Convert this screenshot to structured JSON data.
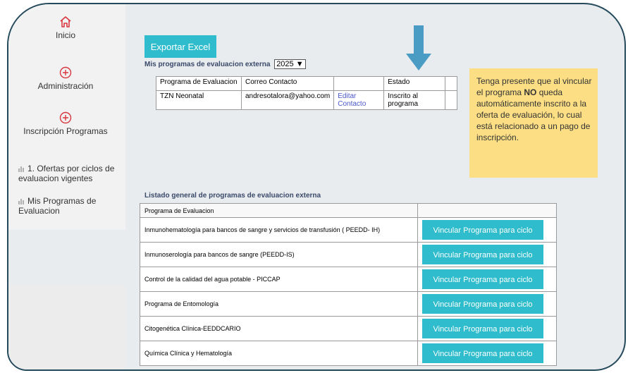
{
  "sidebar": {
    "home_label": "Inicio",
    "admin_label": "Administración",
    "inscripcion_label": "Inscripción Programas",
    "menu": [
      {
        "label": "1. Ofertas por ciclos de evaluacion vigentes"
      },
      {
        "label": "Mis Programas de Evaluacion"
      }
    ]
  },
  "toolbar": {
    "export_label": "Exportar Excel"
  },
  "my_programs": {
    "title": "Mis programas de evaluacion externa",
    "year": "2025",
    "headers": [
      "Programa de Evaluacion",
      "Correo Contacto",
      "",
      "Estado",
      ""
    ],
    "row": {
      "program": "TZN Neonatal",
      "email": "andresotalora@yahoo.com",
      "edit_link": "Editar Contacto",
      "status": "Inscrito al programa"
    }
  },
  "note": {
    "part1": "Tenga presente que al vincular el programa ",
    "bold": "NO",
    "part2": " queda automáticamente inscrito a la oferta de evaluación, lo cual está relacionado a un pago de inscripción."
  },
  "general_list": {
    "title": "Listado general de programas de evaluacion externa",
    "header": "Programa de Evaluacion",
    "button_label": "Vincular Programa para ciclo",
    "rows": [
      "Inmunohematología para bancos de sangre y servicios de transfusión ( PEEDD- IH)",
      "Inmunoserología para bancos de sangre (PEEDD-IS)",
      "Control de la calidad del agua potable - PICCAP",
      "Programa de Entomología",
      "Citogenética Clínica-EEDDCARIO",
      "Química Clínica y Hematología"
    ]
  },
  "colors": {
    "accent": "#2fbccd",
    "note_bg": "#fcdf84",
    "home_icon": "#d9363e",
    "arrow": "#4a9cc4"
  }
}
